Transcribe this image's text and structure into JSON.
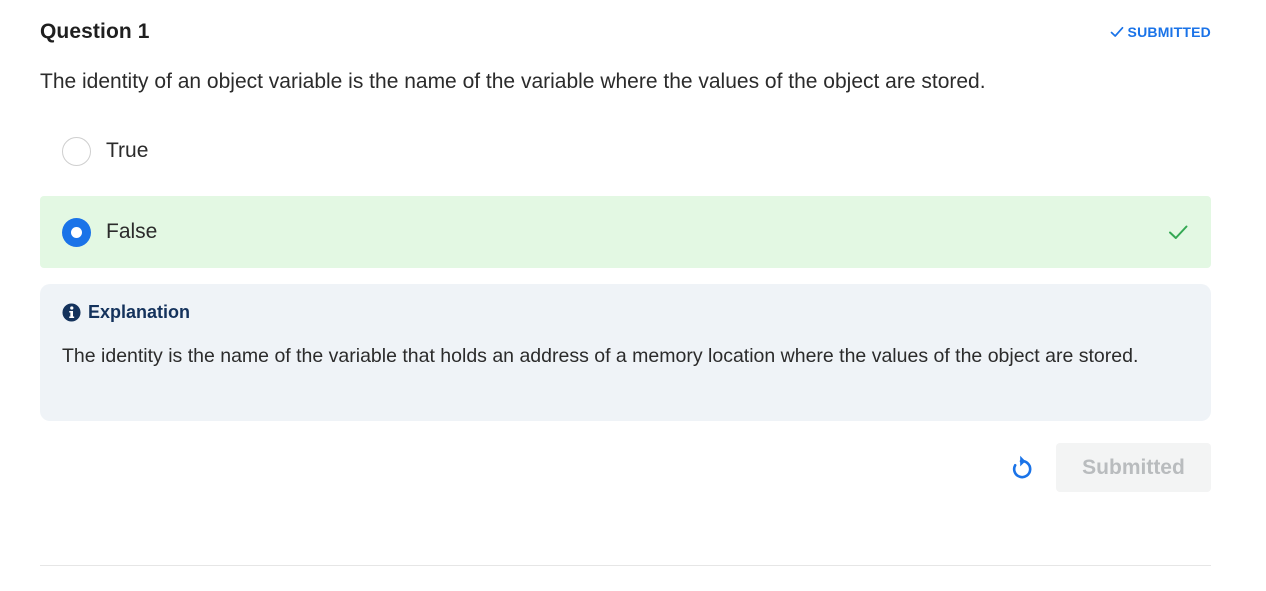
{
  "header": {
    "title": "Question 1",
    "status": "SUBMITTED",
    "status_icon": "check-icon"
  },
  "question": {
    "text": "The identity of an object variable is the name of the variable where the values of the object are stored."
  },
  "options": [
    {
      "label": "True",
      "selected": false,
      "correct": false
    },
    {
      "label": "False",
      "selected": true,
      "correct": true
    }
  ],
  "explanation": {
    "icon": "info-icon",
    "heading": "Explanation",
    "body": "The identity is the name of the variable that holds an address of a memory location where the values of the object are stored."
  },
  "actions": {
    "reset_icon": "reset-icon",
    "submit_label": "Submitted",
    "submit_disabled": true
  },
  "colors": {
    "accent": "#1a73e8",
    "correct_bg": "#e3f8e3",
    "correct_check": "#34a853",
    "explanation_bg": "#eff3f7",
    "explanation_heading": "#14325c",
    "button_disabled_bg": "#f3f4f4",
    "button_disabled_text": "#b9bcbe"
  }
}
